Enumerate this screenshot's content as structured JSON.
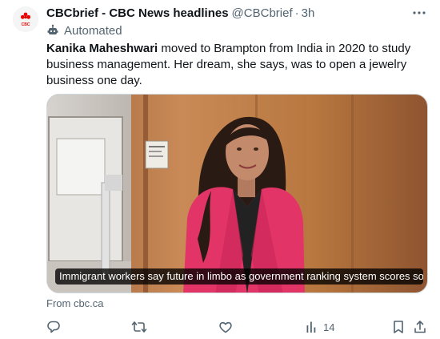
{
  "account": {
    "display_name": "CBCbrief - CBC News headlines",
    "handle": "@CBCbrief",
    "separator": "·",
    "time": "3h",
    "avatar_text": "CBC"
  },
  "automated_label": "Automated",
  "tweet": {
    "name": "Kanika Maheshwari",
    "body": " moved to Brampton from India in 2020 to study business management. Her dream, she says, was to open a jewelry business one day."
  },
  "card": {
    "caption": "Immigrant workers say future in limbo as government ranking system scores soar |..."
  },
  "source": "From cbc.ca",
  "actions": {
    "views": "14"
  },
  "colors": {
    "text": "#0f1419",
    "secondary": "#536471",
    "cbc_red": "#e60505"
  },
  "icons": [
    "cbc-logo-icon",
    "more-icon",
    "robot-icon",
    "reply-icon",
    "retweet-icon",
    "like-icon",
    "views-icon",
    "bookmark-icon",
    "share-icon"
  ]
}
